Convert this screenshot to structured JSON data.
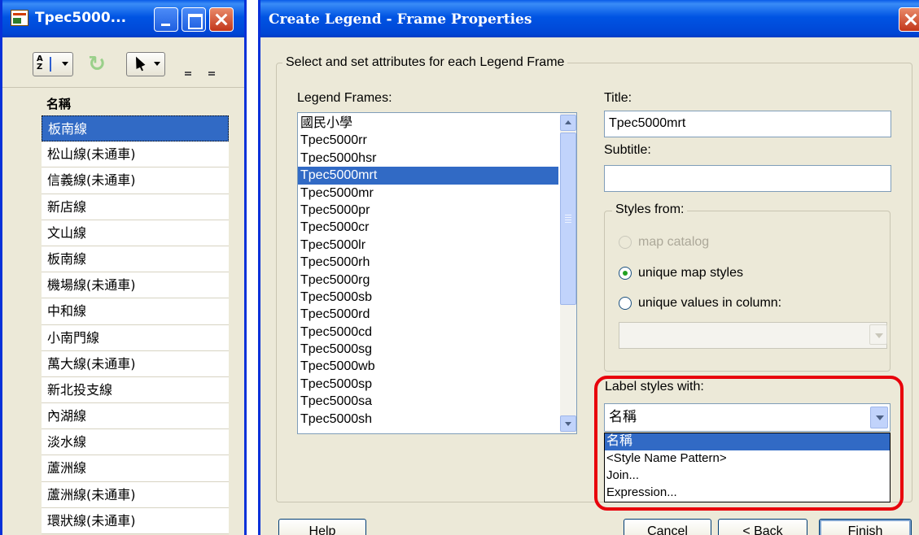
{
  "browser": {
    "title": "Tpec5000...",
    "toolbar": {
      "sort_az_top": "A",
      "sort_az_bottom": "Z",
      "refresh_glyph": "↻"
    },
    "column_header": "名稱",
    "rows": [
      "板南線",
      "松山線(未通車)",
      "信義線(未通車)",
      "新店線",
      "文山線",
      "板南線",
      "機場線(未通車)",
      "中和線",
      "小南門線",
      "萬大線(未通車)",
      "新北投支線",
      "內湖線",
      "淡水線",
      "蘆洲線",
      "蘆洲線(未通車)",
      "環狀線(未通車)"
    ],
    "selected_row_index": 0
  },
  "dialog": {
    "title": "Create Legend - Frame Properties",
    "group_caption": "Select and set attributes for each Legend Frame",
    "legend_frames_label": "Legend Frames:",
    "legend_frames": [
      "國民小學",
      "Tpec5000rr",
      "Tpec5000hsr",
      "Tpec5000mrt",
      "Tpec5000mr",
      "Tpec5000pr",
      "Tpec5000cr",
      "Tpec5000lr",
      "Tpec5000rh",
      "Tpec5000rg",
      "Tpec5000sb",
      "Tpec5000rd",
      "Tpec5000cd",
      "Tpec5000sg",
      "Tpec5000wb",
      "Tpec5000sp",
      "Tpec5000sa",
      "Tpec5000sh"
    ],
    "selected_frame_index": 3,
    "title_label": "Title:",
    "title_value": "Tpec5000mrt",
    "subtitle_label": "Subtitle:",
    "subtitle_value": "",
    "styles_from": {
      "caption": "Styles from:",
      "options": [
        "map catalog",
        "unique map styles",
        "unique values in column:"
      ],
      "selected": "unique map styles",
      "column_value": ""
    },
    "label_styles": {
      "label": "Label styles with:",
      "value": "名稱",
      "options": [
        "名稱",
        "<Style Name Pattern>",
        "Join...",
        "Expression..."
      ],
      "selected_index": 0
    },
    "buttons": {
      "help": "Help",
      "cancel": "Cancel",
      "back": "< Back",
      "finish": "Finish"
    }
  },
  "colors": {
    "selection": "#316ac5",
    "highlight_frame": "#e8000b",
    "titlebar": "#0054e3",
    "dialog_bg": "#ece9d8"
  }
}
